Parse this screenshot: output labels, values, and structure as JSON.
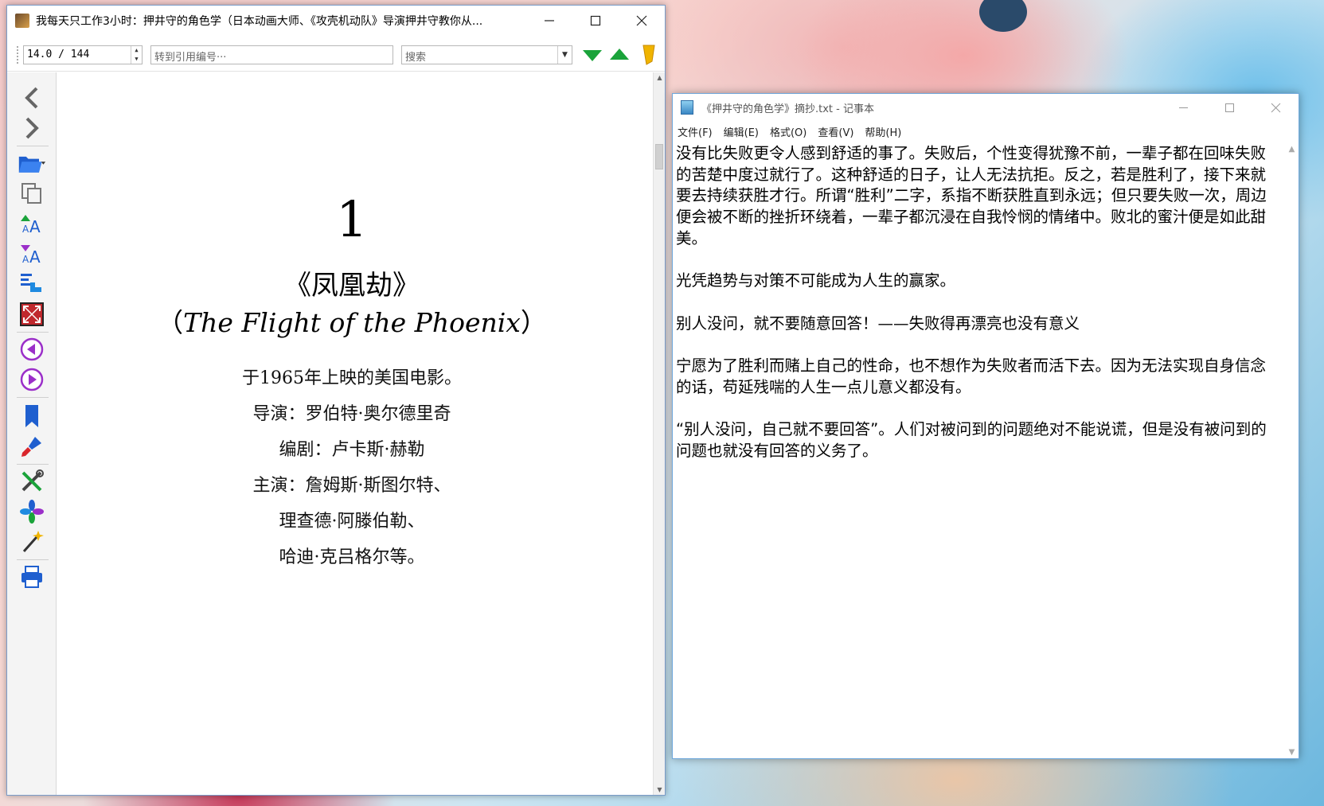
{
  "reader": {
    "title": "我每天只工作3小时：押井守的角色学（日本动画大师、《攻壳机动队》导演押井守教你从...",
    "toolbar": {
      "page_value": "14.0 / 144",
      "ref_placeholder": "转到引用编号···",
      "search_placeholder": "搜索"
    },
    "sidebar_icons": [
      "back-icon",
      "forward-icon",
      "open-folder-icon",
      "copy-icon",
      "font-increase-icon",
      "font-decrease-icon",
      "reflow-icon",
      "fullscreen-icon",
      "previous-icon",
      "next-icon",
      "bookmark-icon",
      "highlight-icon",
      "tools-icon",
      "theme-icon",
      "magic-wand-icon",
      "print-icon"
    ],
    "page": {
      "chapter_number": "1",
      "title": "《凤凰劫》",
      "subtitle_open": "（",
      "subtitle_italic": "The Flight of the Phoenix",
      "subtitle_close": "）",
      "lines": [
        "于1965年上映的美国电影。",
        "导演：罗伯特·奥尔德里奇",
        "编剧：卢卡斯·赫勒",
        "主演：詹姆斯·斯图尔特、",
        "理查德·阿滕伯勒、",
        "哈迪·克吕格尔等。"
      ]
    }
  },
  "notepad": {
    "title": "《押井守的角色学》摘抄.txt - 记事本",
    "menu": [
      "文件(F)",
      "编辑(E)",
      "格式(O)",
      "查看(V)",
      "帮助(H)"
    ],
    "content": "没有比失败更令人感到舒适的事了。失败后，个性变得犹豫不前，一辈子都在回味失败的苦楚中度过就行了。这种舒适的日子，让人无法抗拒。反之，若是胜利了，接下来就要去持续获胜才行。所谓“胜利”二字，系指不断获胜直到永远；但只要失败一次，周边便会被不断的挫折环绕着，一辈子都沉浸在自我怜悯的情绪中。败北的蜜汁便是如此甜美。\n\n光凭趋势与对策不可能成为人生的赢家。\n\n别人没问，就不要随意回答！——失败得再漂亮也没有意义\n\n宁愿为了胜利而赌上自己的性命，也不想作为失败者而活下去。因为无法实现自身信念的话，苟延残喘的人生一点儿意义都没有。\n\n“别人没问，自己就不要回答”。人们对被问到的问题绝对不能说谎，但是没有被问到的问题也就没有回答的义务了。"
  },
  "colors": {
    "accent_green": "#1aa33a",
    "accent_blue": "#1f5fcf",
    "accent_purple": "#9b2fc9"
  }
}
